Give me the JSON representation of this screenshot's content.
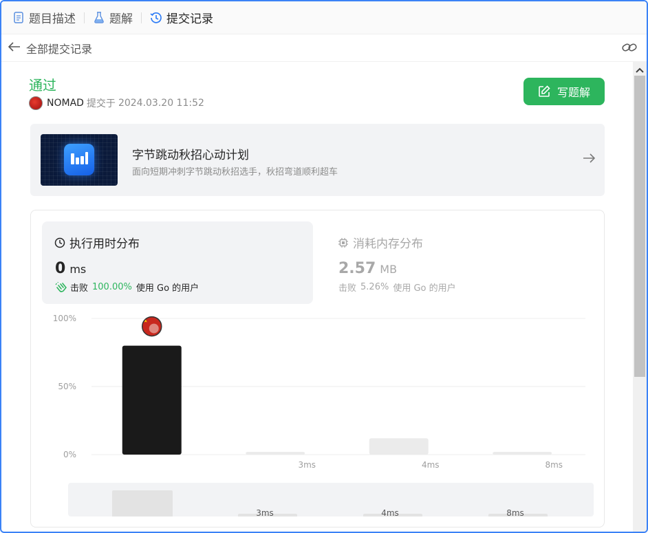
{
  "tabs": [
    {
      "label": "题目描述",
      "icon": "document-icon"
    },
    {
      "label": "题解",
      "icon": "flask-icon"
    },
    {
      "label": "提交记录",
      "icon": "history-icon",
      "active": true
    }
  ],
  "subbar": {
    "title": "全部提交记录"
  },
  "submission": {
    "status": "通过",
    "user": "NOMAD",
    "submitted_prefix": "提交于",
    "time": "2024.03.20 11:52",
    "write_button": "写题解"
  },
  "promo": {
    "title": "字节跳动秋招心动计划",
    "subtitle": "面向短期冲刺字节跳动秋招选手，秋招弯道顺利超车"
  },
  "runtime": {
    "title": "执行用时分布",
    "value": "0",
    "unit": "ms",
    "beat_label": "击败",
    "beat_pct": "100.00%",
    "beat_suffix": "使用 Go 的用户"
  },
  "memory": {
    "title": "消耗内存分布",
    "value": "2.57",
    "unit": "MB",
    "beat_label": "击败",
    "beat_pct": "5.26%",
    "beat_suffix": "使用 Go 的用户"
  },
  "colors": {
    "accent": "#2db55d",
    "bar_active": "#1a1a1a",
    "bar_inactive": "#ebebeb"
  },
  "chart_data": {
    "type": "bar",
    "categories": [
      "",
      "3ms",
      "4ms",
      "8ms"
    ],
    "values": [
      80,
      2,
      12,
      2
    ],
    "yticks": [
      "100%",
      "50%",
      "0%"
    ],
    "ylim": [
      0,
      100
    ],
    "highlight_index": 0,
    "minimap_labels": [
      "",
      "3ms",
      "4ms",
      "8ms"
    ],
    "minimap_values": [
      40,
      6,
      6,
      6
    ]
  }
}
